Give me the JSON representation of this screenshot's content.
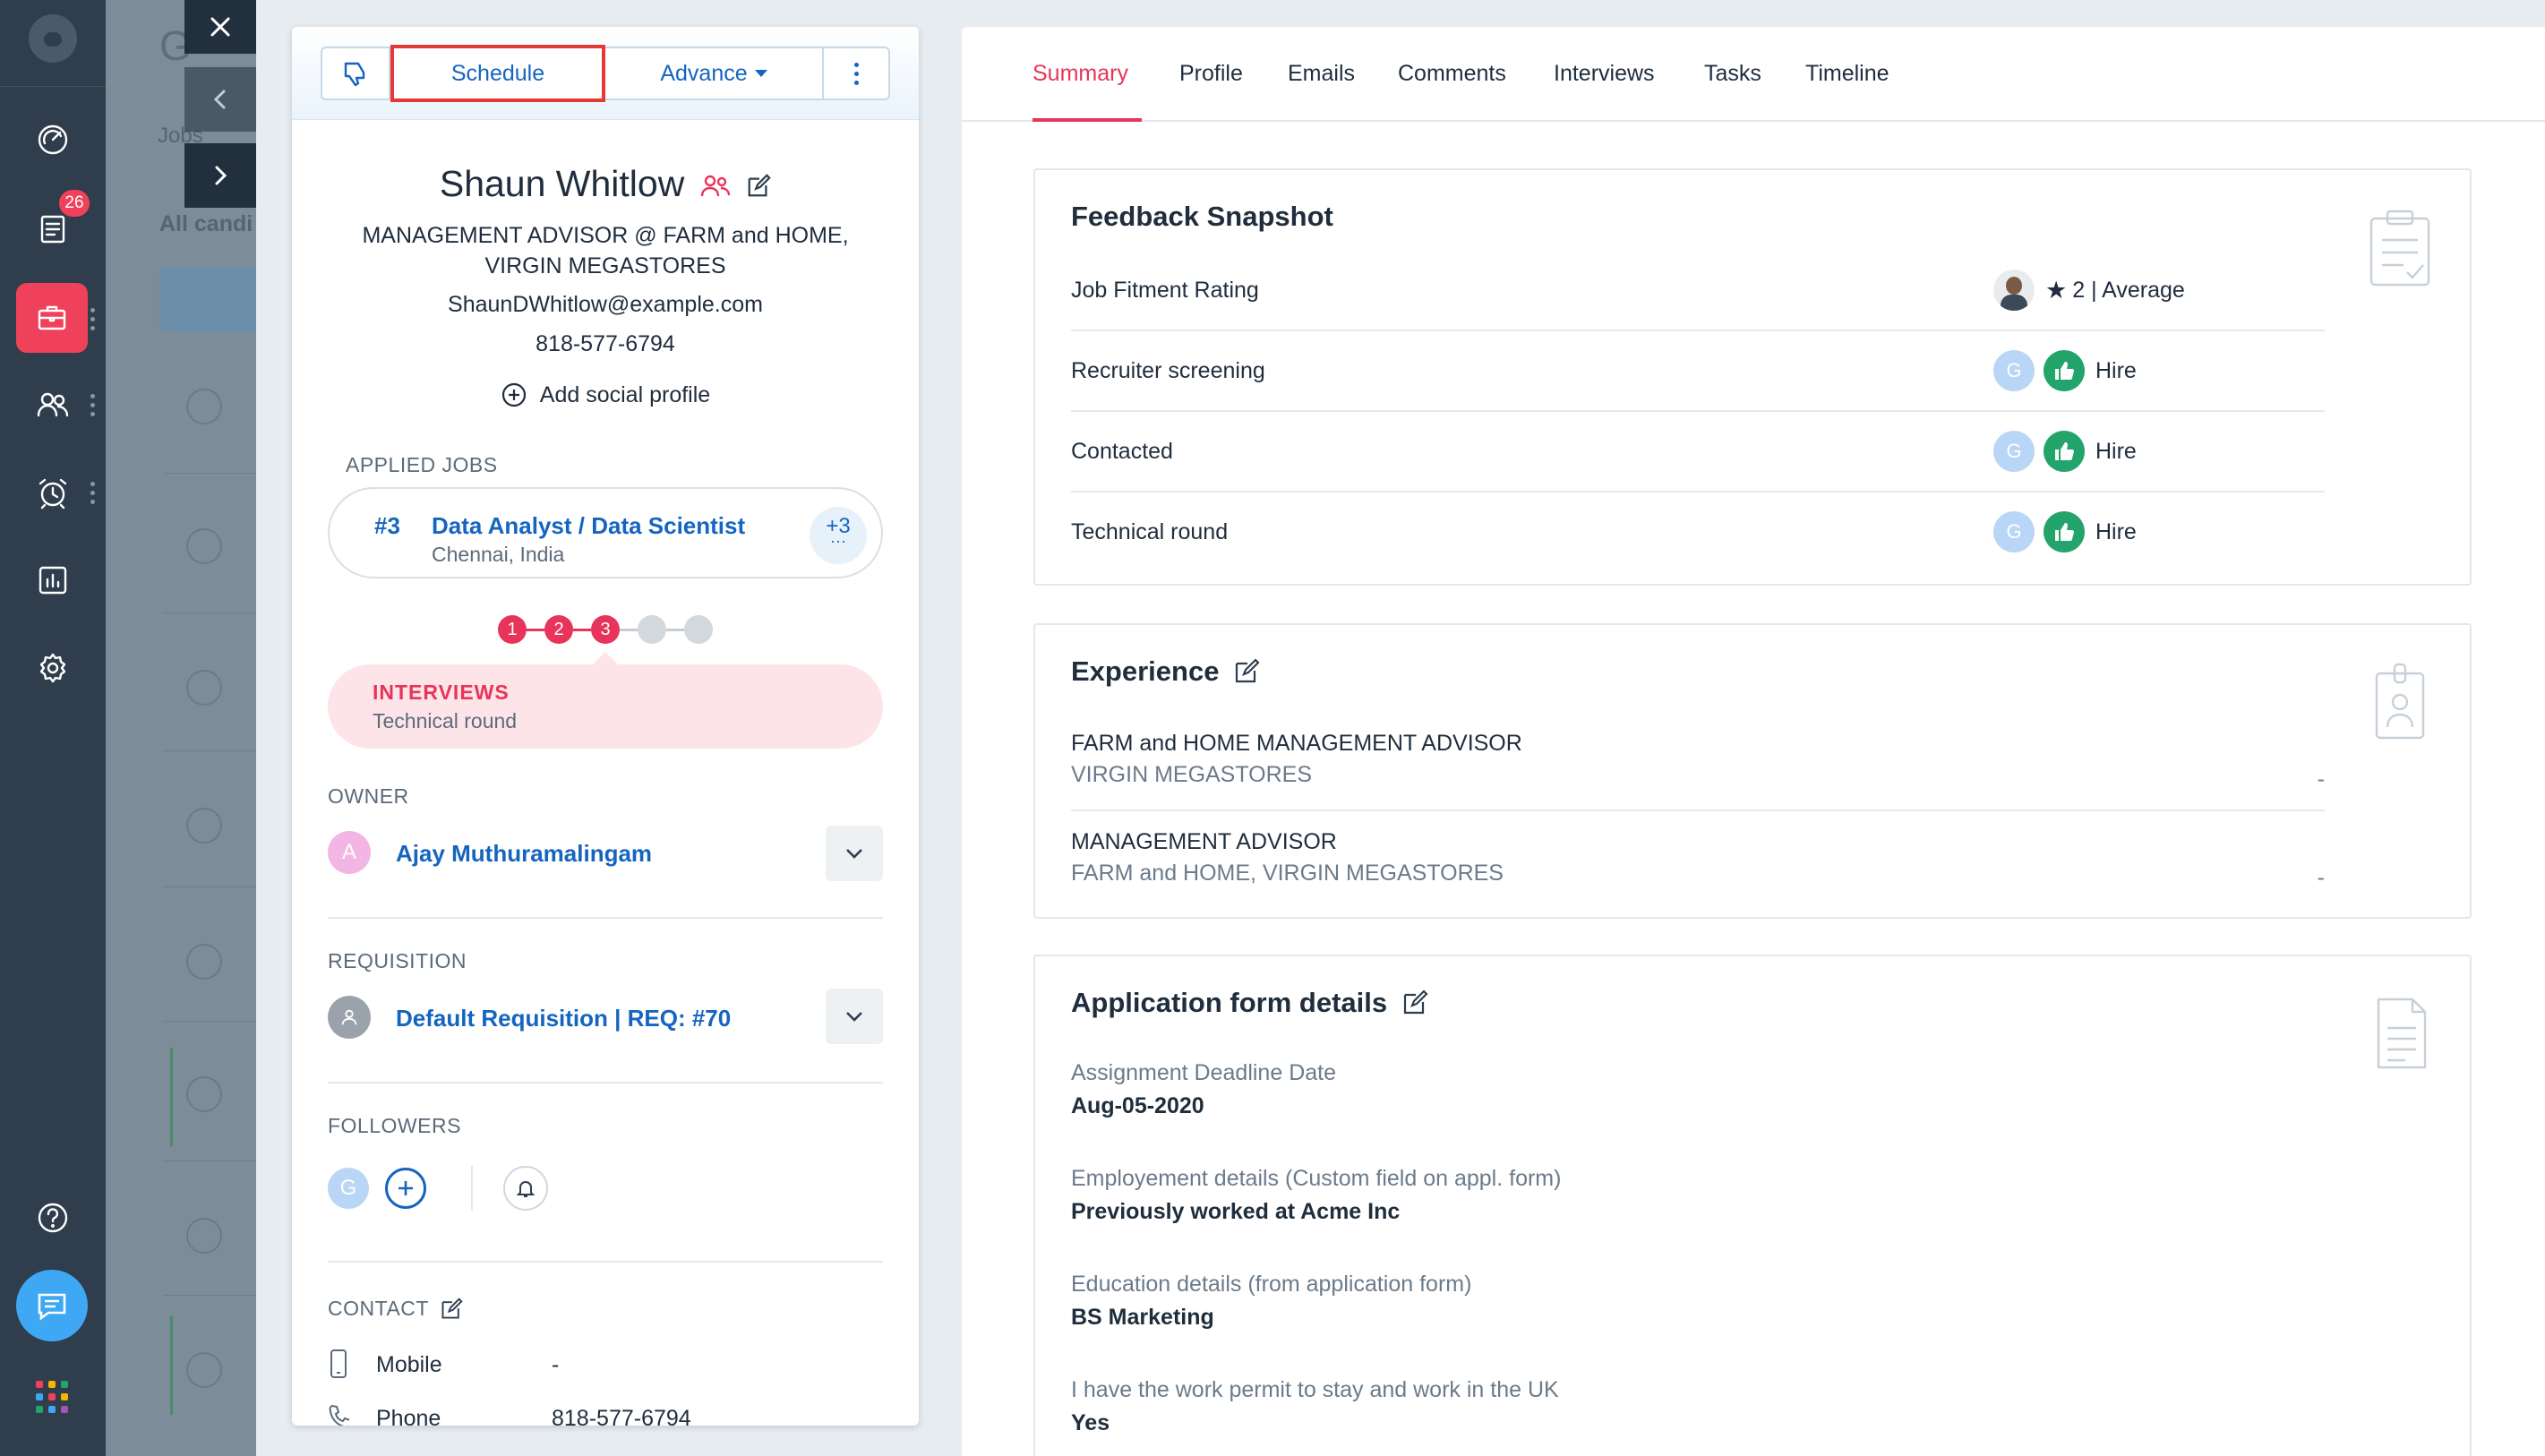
{
  "sidebar": {
    "notification_count": "26",
    "items": [
      {
        "icon": "dashboard-icon"
      },
      {
        "icon": "tasks-icon"
      },
      {
        "icon": "briefcase-icon",
        "active": true
      },
      {
        "icon": "candidates-icon"
      },
      {
        "icon": "alarm-clock-icon"
      },
      {
        "icon": "reports-icon"
      },
      {
        "icon": "settings-icon"
      }
    ],
    "colors": {
      "background": "#2f3d4c",
      "active": "#f0415a",
      "chat": "#3fa8f4"
    }
  },
  "background_list": {
    "tab_label": "Jobs",
    "filter_label": "All candi"
  },
  "toolbar": {
    "schedule_label": "Schedule",
    "advance_label": "Advance"
  },
  "candidate": {
    "name": "Shaun Whitlow",
    "title": "MANAGEMENT ADVISOR @ FARM and HOME, VIRGIN MEGASTORES",
    "email": "ShaunDWhitlow@example.com",
    "phone": "818-577-6794",
    "add_social_label": "Add social profile"
  },
  "applied_jobs": {
    "label": "APPLIED JOBS",
    "job_number": "#3",
    "job_title": "Data Analyst / Data Scientist",
    "job_location": "Chennai, India",
    "more_count": "+3",
    "more_dots": "···"
  },
  "stages": {
    "steps": [
      "1",
      "2",
      "3",
      "",
      ""
    ],
    "completed": 3,
    "current_stage": "INTERVIEWS",
    "current_sub": "Technical round"
  },
  "owner": {
    "label": "OWNER",
    "initial": "A",
    "name": "Ajay Muthuramalingam"
  },
  "requisition": {
    "label": "REQUISITION",
    "value": "Default Requisition | REQ: #70"
  },
  "followers": {
    "label": "FOLLOWERS",
    "initial": "G"
  },
  "contact": {
    "label": "CONTACT",
    "rows": [
      {
        "label": "Mobile",
        "value": "-"
      },
      {
        "label": "Phone",
        "value": "818-577-6794"
      }
    ]
  },
  "tabs": [
    "Summary",
    "Profile",
    "Emails",
    "Comments",
    "Interviews",
    "Tasks",
    "Timeline"
  ],
  "feedback": {
    "title": "Feedback Snapshot",
    "rows": [
      {
        "label": "Job Fitment Rating",
        "rating": "2",
        "rating_text": "| Average"
      },
      {
        "label": "Recruiter screening",
        "avatar": "G",
        "result": "Hire"
      },
      {
        "label": "Contacted",
        "avatar": "G",
        "result": "Hire"
      },
      {
        "label": "Technical round",
        "avatar": "G",
        "result": "Hire"
      }
    ]
  },
  "experience": {
    "title": "Experience",
    "items": [
      {
        "role": "FARM and HOME MANAGEMENT ADVISOR",
        "company": "VIRGIN MEGASTORES",
        "period": "-"
      },
      {
        "role": "MANAGEMENT ADVISOR",
        "company": "FARM and HOME, VIRGIN MEGASTORES",
        "period": "-"
      }
    ]
  },
  "application_form": {
    "title": "Application form details",
    "items": [
      {
        "question": "Assignment Deadline Date",
        "answer": "Aug-05-2020"
      },
      {
        "question": "Employement details (Custom field on appl. form)",
        "answer": "Previously worked at Acme Inc"
      },
      {
        "question": "Education details (from application form)",
        "answer": "BS Marketing"
      },
      {
        "question": "I have the work permit to stay and work in the UK",
        "answer": "Yes"
      }
    ]
  }
}
